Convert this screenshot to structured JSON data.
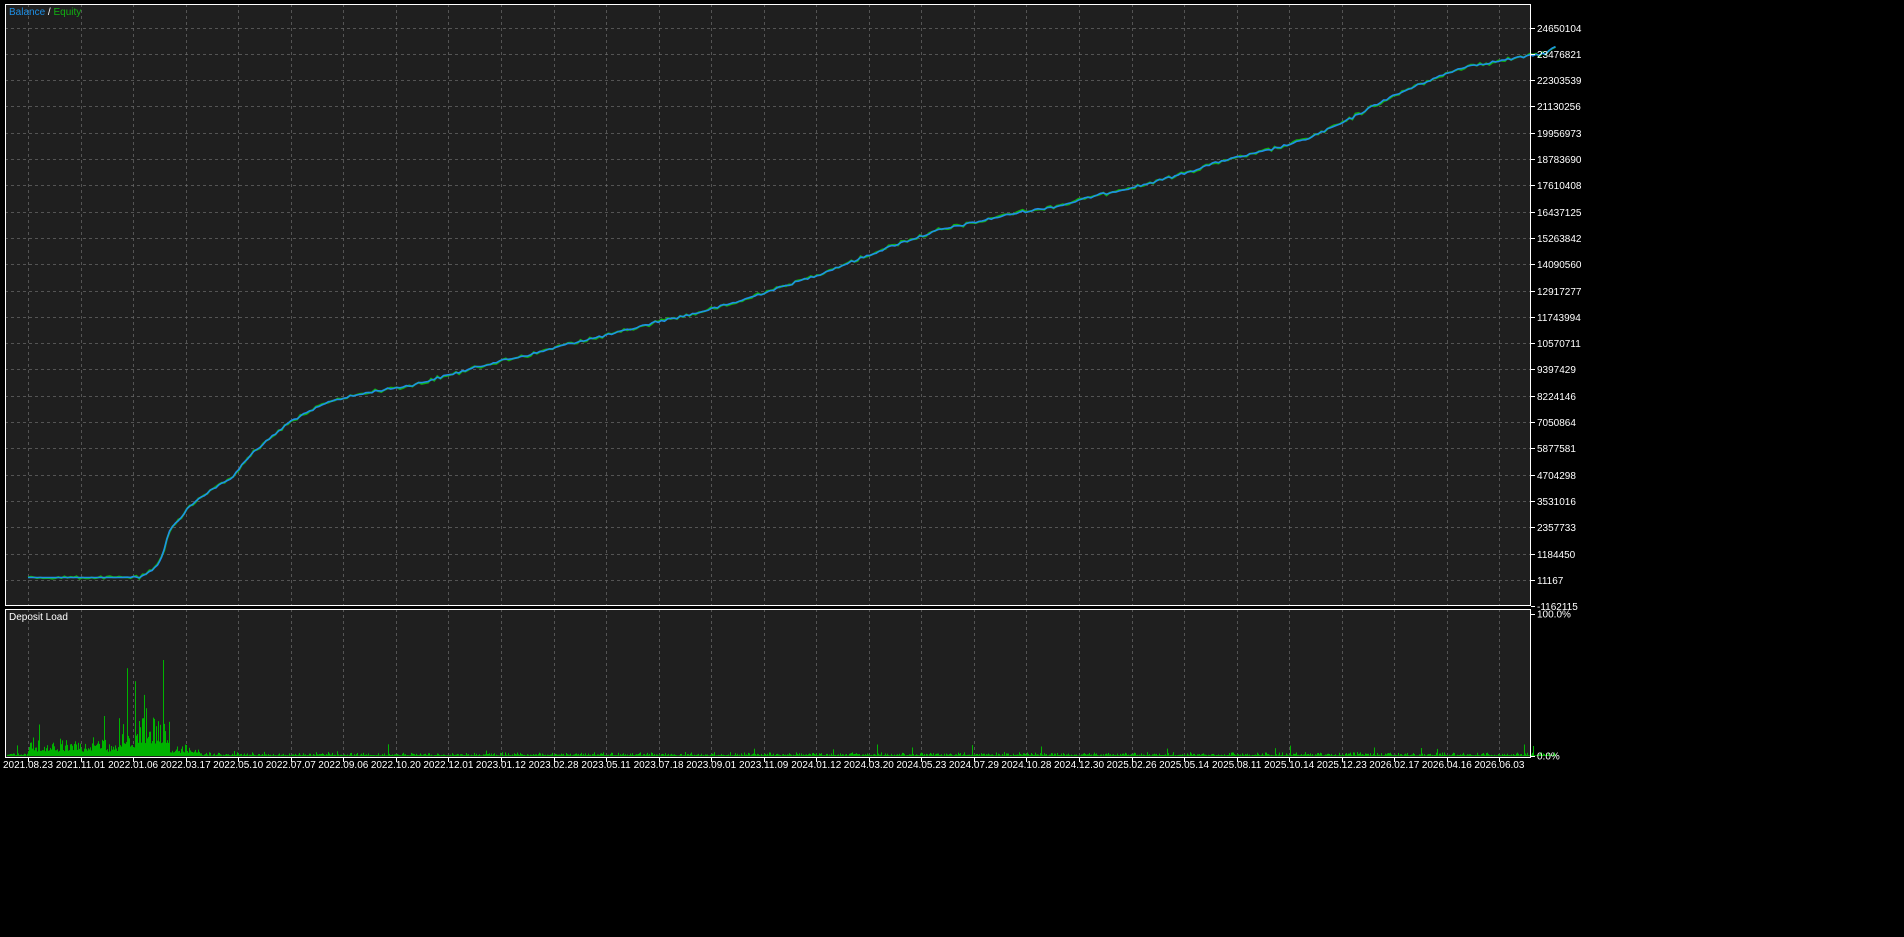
{
  "colors": {
    "background": "#1f1f1f",
    "frame": "#ffffff",
    "grid": "#6b6b6b",
    "balance": "#1e90e6",
    "equity": "#12b012",
    "deposit_load": "#00b300",
    "text": "#ffffff"
  },
  "legend": {
    "balance": "Balance",
    "separator": " / ",
    "equity": "Equity"
  },
  "chart_data": [
    {
      "type": "line",
      "title": "",
      "series": [
        {
          "name": "Balance",
          "color": "#1e90e6"
        },
        {
          "name": "Equity",
          "color": "#12b012"
        }
      ],
      "y_tick_labels": [
        "24650104",
        "23476821",
        "22303539",
        "21130256",
        "19956973",
        "18783690",
        "17610408",
        "16437125",
        "15263842",
        "14090560",
        "12917277",
        "11743994",
        "10570711",
        "9397429",
        "8224146",
        "7050864",
        "5877581",
        "4704298",
        "3531016",
        "2357733",
        "1184450",
        "11167",
        "-1162115"
      ],
      "x_tick_labels": [
        "2021.08.23",
        "2021.11.01",
        "2022.01.06",
        "2022.03.17",
        "2022.05.10",
        "2022.07.07",
        "2022.09.06",
        "2022.10.20",
        "2022.12.01",
        "2023.01.12",
        "2023.02.28",
        "2023.05.11",
        "2023.07.18",
        "2023.09.01",
        "2023.11.09",
        "2024.01.12",
        "2024.03.20",
        "2024.05.23",
        "2024.07.29",
        "2024.10.28",
        "2024.12.30",
        "2025.02.26",
        "2025.05.14",
        "2025.08.11",
        "2025.10.14",
        "2025.12.23",
        "2026.02.17",
        "2026.04.16",
        "2026.06.03"
      ],
      "ylim": [
        -1162115,
        25500000
      ],
      "points": [
        [
          0,
          111674
        ],
        [
          0.45,
          111674
        ],
        [
          0.55,
          150000
        ],
        [
          0.6,
          350000
        ],
        [
          0.64,
          700000
        ],
        [
          0.66,
          1000000
        ],
        [
          0.7,
          2200000
        ],
        [
          0.8,
          3300000
        ],
        [
          0.9,
          4000000
        ],
        [
          1.0,
          4500000
        ],
        [
          1.1,
          5600000
        ],
        [
          1.3,
          7100000
        ],
        [
          1.5,
          8000000
        ],
        [
          1.7,
          8400000
        ],
        [
          1.9,
          8700000
        ],
        [
          2.1,
          9200000
        ],
        [
          2.3,
          9700000
        ],
        [
          2.5,
          10100000
        ],
        [
          2.7,
          10600000
        ],
        [
          2.9,
          11000000
        ],
        [
          3.1,
          11500000
        ],
        [
          3.3,
          11900000
        ],
        [
          3.5,
          12400000
        ],
        [
          3.7,
          13000000
        ],
        [
          3.9,
          13600000
        ],
        [
          4.1,
          14300000
        ],
        [
          4.3,
          15000000
        ],
        [
          4.5,
          15600000
        ],
        [
          4.7,
          16000000
        ],
        [
          4.9,
          16400000
        ],
        [
          5.1,
          16700000
        ],
        [
          5.3,
          17200000
        ],
        [
          5.5,
          17600000
        ],
        [
          5.7,
          18100000
        ],
        [
          5.9,
          18700000
        ],
        [
          6.1,
          19100000
        ],
        [
          6.3,
          19600000
        ],
        [
          6.5,
          20400000
        ],
        [
          6.7,
          21400000
        ],
        [
          6.9,
          22200000
        ],
        [
          7.1,
          22900000
        ],
        [
          7.3,
          23200000
        ],
        [
          7.5,
          23500000
        ],
        [
          7.55,
          23800000
        ]
      ]
    },
    {
      "type": "bar",
      "title": "Deposit Load",
      "ylim": [
        0,
        100
      ],
      "y_tick_labels": [
        "100.0%",
        "0.0%"
      ],
      "seed": 20210823,
      "segments": [
        {
          "t0": 0.0,
          "t1": 0.45,
          "base": 3,
          "spread": 14,
          "spike": 0.06,
          "spike_max": 35
        },
        {
          "t0": 0.45,
          "t1": 0.55,
          "base": 6,
          "spread": 22,
          "spike": 0.12,
          "spike_max": 60
        },
        {
          "t0": 0.55,
          "t1": 0.7,
          "base": 8,
          "spread": 25,
          "spike": 0.16,
          "spike_max": 72
        },
        {
          "t0": 0.7,
          "t1": 0.85,
          "base": 2,
          "spread": 8,
          "spike": 0.04,
          "spike_max": 30
        },
        {
          "t0": 0.85,
          "t1": 7.55,
          "base": 0.4,
          "spread": 2.5,
          "spike": 0.02,
          "spike_max": 8
        }
      ]
    }
  ]
}
